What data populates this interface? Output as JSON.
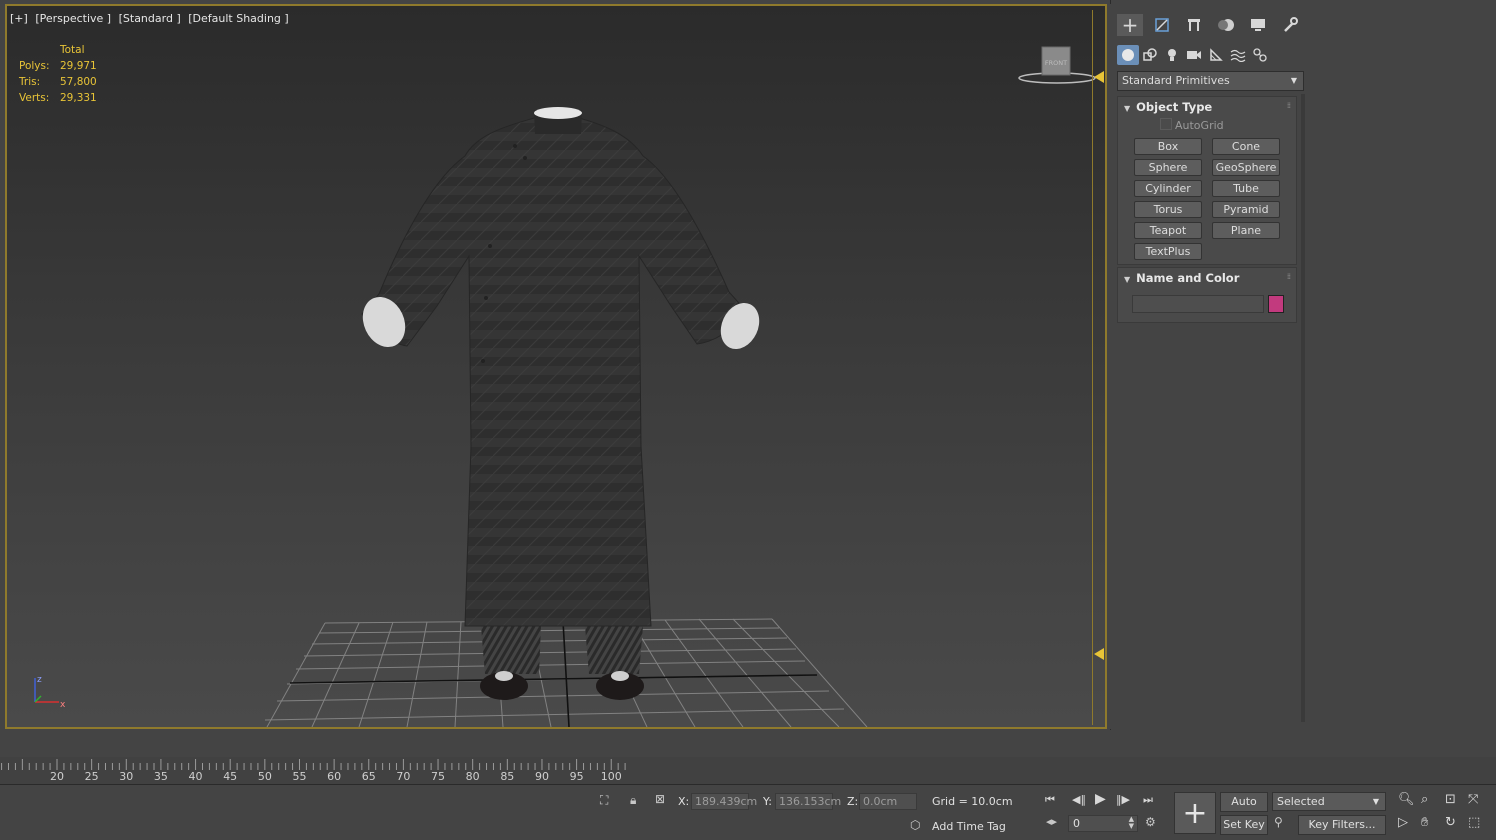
{
  "viewport": {
    "labels": [
      "[+]",
      "[Perspective ]",
      "[Standard ]",
      "[Default Shading ]"
    ],
    "stats": {
      "header": "Total",
      "rows": [
        {
          "label": "Polys:",
          "value": "29,971"
        },
        {
          "label": "Tris:",
          "value": "57,800"
        },
        {
          "label": "Verts:",
          "value": "29,331"
        }
      ]
    },
    "viewcube_label": "FRONT",
    "axis": {
      "z": "z",
      "x": "x"
    }
  },
  "command_panel": {
    "top_tabs": [
      "create-icon",
      "modify-icon",
      "hierarchy-icon",
      "motion-icon",
      "display-icon",
      "utilities-icon"
    ],
    "sub_tabs": [
      "geometry-icon",
      "shapes-icon",
      "lights-icon",
      "cameras-icon",
      "helpers-icon",
      "space-warps-icon",
      "systems-icon"
    ],
    "category_dropdown": "Standard Primitives",
    "object_type": {
      "title": "Object Type",
      "autogrid_label": "AutoGrid",
      "buttons": [
        "Box",
        "Cone",
        "Sphere",
        "GeoSphere",
        "Cylinder",
        "Tube",
        "Torus",
        "Pyramid",
        "Teapot",
        "Plane",
        "TextPlus"
      ]
    },
    "name_and_color": {
      "title": "Name and Color",
      "name_value": "",
      "color": "#c23a7e"
    }
  },
  "timeline": {
    "ticks": [
      "20",
      "25",
      "30",
      "35",
      "40",
      "45",
      "50",
      "55",
      "60",
      "65",
      "70",
      "75",
      "80",
      "85",
      "90",
      "95",
      "100"
    ]
  },
  "status_bar": {
    "x_label": "X:",
    "x_value": "189.439cm",
    "y_label": "Y:",
    "y_value": "136.153cm",
    "z_label": "Z:",
    "z_value": "0.0cm",
    "grid": "Grid = 10.0cm",
    "add_time_tag": "Add Time Tag",
    "frame_value": "0",
    "auto_key": "Auto Key",
    "set_key": "Set Key",
    "selected": "Selected",
    "key_filters": "Key Filters..."
  }
}
